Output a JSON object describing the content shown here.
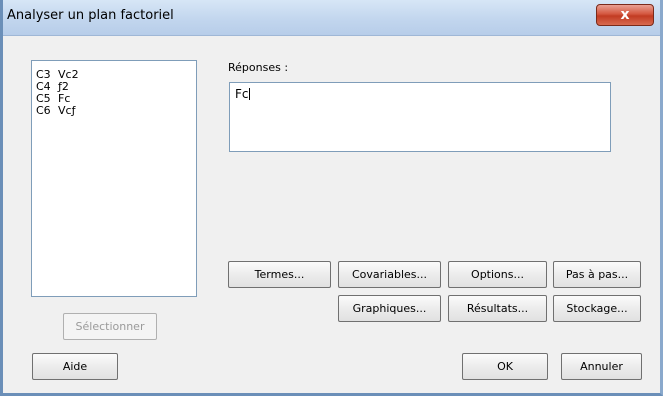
{
  "window": {
    "title": "Analyser un plan factoriel",
    "close_label": "x"
  },
  "variables": [
    {
      "col": "C3",
      "name": "Vc2"
    },
    {
      "col": "C4",
      "name": "ƒ2"
    },
    {
      "col": "C5",
      "name": "Fc"
    },
    {
      "col": "C6",
      "name": "Vcƒ"
    }
  ],
  "responses": {
    "label": "Réponses :",
    "value": "Fc"
  },
  "buttons": {
    "termes": "Termes...",
    "covariables": "Covariables...",
    "options": "Options...",
    "pas_a_pas": "Pas à pas...",
    "graphiques": "Graphiques...",
    "resultats": "Résultats...",
    "stockage": "Stockage...",
    "selectionner": "Sélectionner",
    "aide": "Aide",
    "ok": "OK",
    "annuler": "Annuler"
  }
}
